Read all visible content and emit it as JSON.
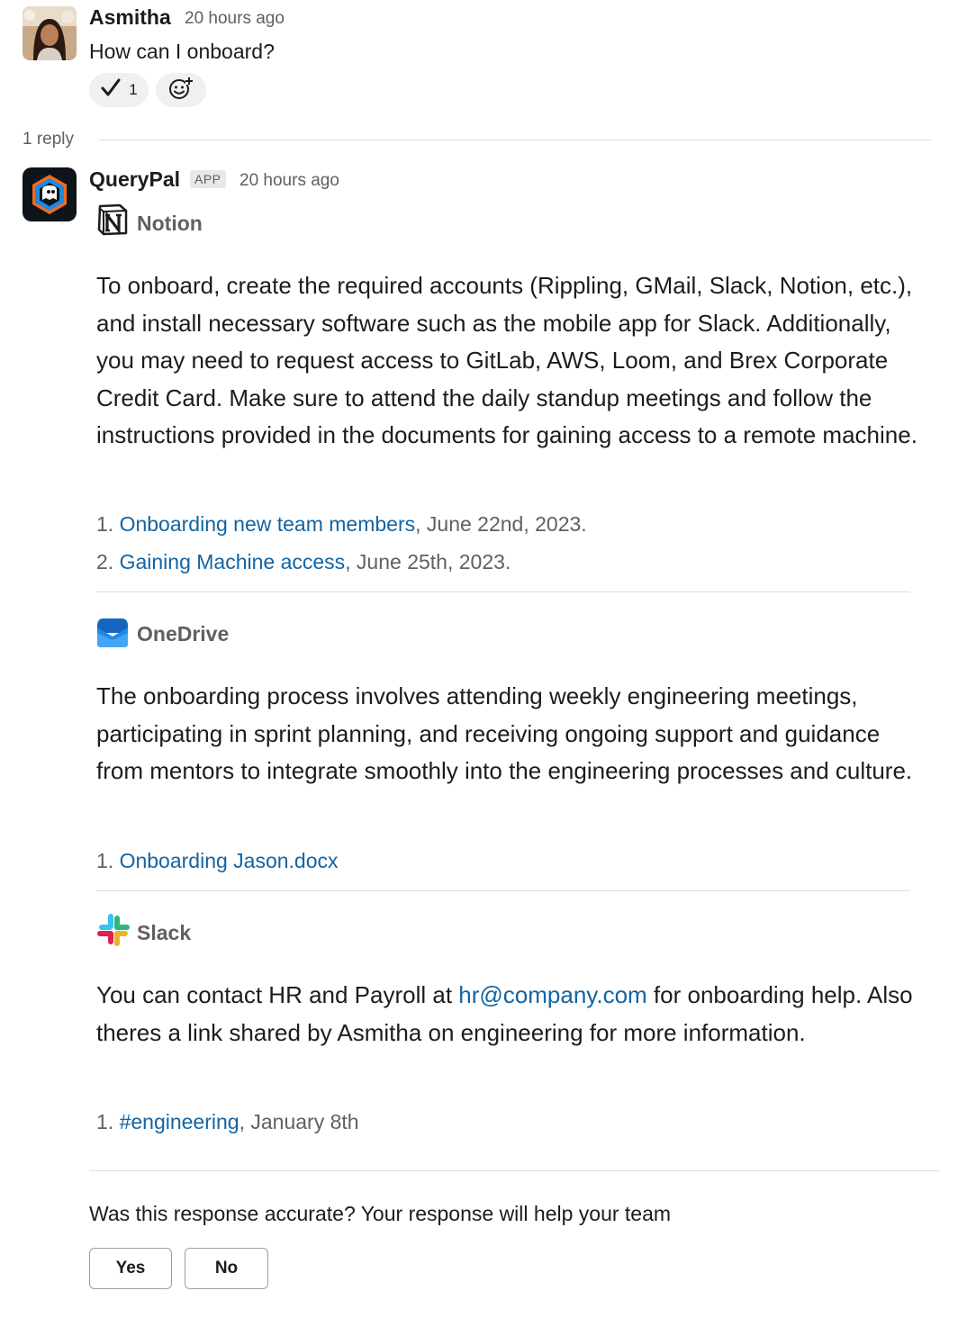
{
  "original_message": {
    "author": "Asmitha",
    "timestamp": "20 hours ago",
    "text": "How can I onboard?",
    "reactions": [
      {
        "icon": "checkmark-icon",
        "count": "1"
      }
    ],
    "add_reaction_icon": "add-reaction-icon"
  },
  "thread": {
    "reply_count": "1 reply"
  },
  "reply": {
    "author": "QueryPal",
    "badge": "APP",
    "timestamp": "20 hours ago",
    "sources": [
      {
        "name": "Notion",
        "icon": "notion-icon",
        "text": "To onboard, create the required accounts (Rippling, GMail, Slack, Notion, etc.), and install necessary software such as the mobile app for Slack. Additionally, you may need to request access to GitLab, AWS, Loom, and Brex Corporate Credit Card. Make sure to attend the daily standup meetings and follow the instructions provided in the documents for gaining access to a remote machine.",
        "references": [
          {
            "num": "1.",
            "link": "Onboarding new team members",
            "suffix": ", June 22nd, 2023."
          },
          {
            "num": "2.",
            "link": "Gaining Machine access",
            "suffix": ", June 25th, 2023."
          }
        ]
      },
      {
        "name": "OneDrive",
        "icon": "onedrive-icon",
        "text": "The onboarding process involves attending weekly engineering meetings, participating in sprint planning, and receiving ongoing support and guidance from mentors to integrate smoothly into the engineering processes and culture.",
        "references": [
          {
            "num": "1.",
            "link": "Onboarding Jason.docx",
            "suffix": ""
          }
        ]
      },
      {
        "name": "Slack",
        "icon": "slack-icon",
        "text_before": "You can contact HR and Payroll at ",
        "email": "hr@company.com",
        "text_after": " for onboarding help. Also theres a link shared by Asmitha on engineering for more information.",
        "references": [
          {
            "num": "1.",
            "link": "#engineering",
            "suffix": ", January 8th"
          }
        ]
      }
    ],
    "feedback": {
      "question": "Was this response accurate? Your response will help your team",
      "yes_label": "Yes",
      "no_label": "No"
    }
  },
  "colors": {
    "link": "#1264a3",
    "muted": "#616061",
    "text": "#1d1c1d"
  }
}
